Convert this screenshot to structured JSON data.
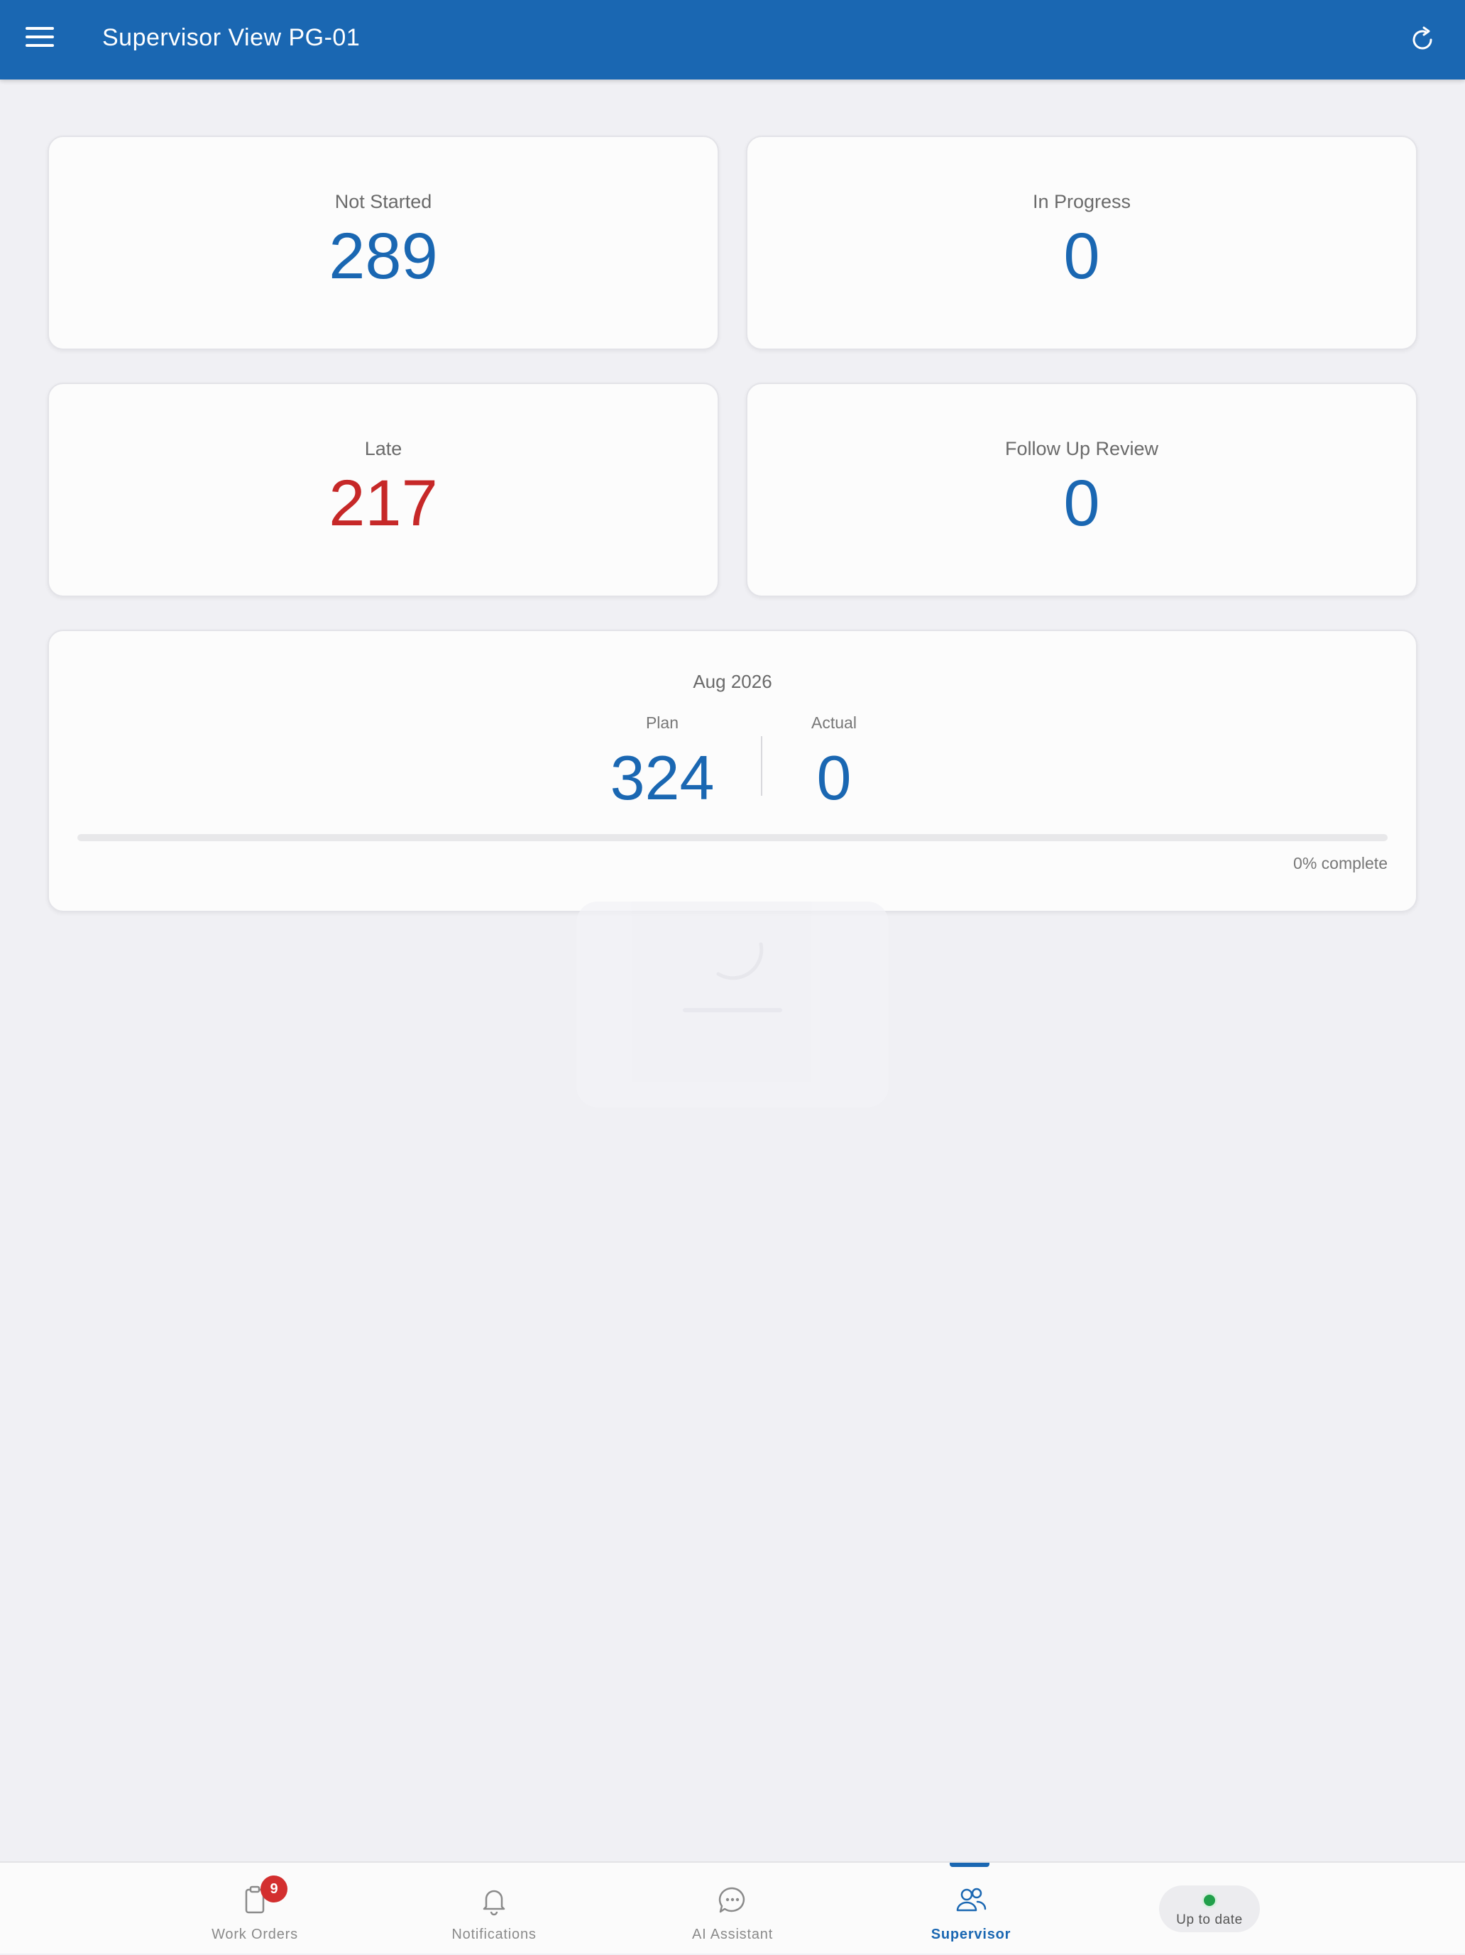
{
  "header": {
    "title": "Supervisor View PG-01",
    "menu_icon": "hamburger-menu-icon",
    "refresh_icon": "refresh-icon"
  },
  "stats": [
    {
      "label": "Not Started",
      "value": "289"
    },
    {
      "label": "In Progress",
      "value": "0"
    },
    {
      "label": "Late",
      "value": "217"
    },
    {
      "label": "Follow Up Review",
      "value": "0"
    }
  ],
  "month_summary": {
    "month": "Aug 2026",
    "plan_label": "Plan",
    "plan_value": "324",
    "actual_label": "Actual",
    "actual_value": "0",
    "progress_percent": 0,
    "progress_text": "0% complete"
  },
  "bottom_nav": {
    "items": [
      {
        "label": "Work Orders",
        "icon": "clipboard-icon",
        "badge": "9"
      },
      {
        "label": "Notifications",
        "icon": "bell-icon"
      },
      {
        "label": "AI Assistant",
        "icon": "chat-bubble-icon"
      },
      {
        "label": "Supervisor",
        "icon": "users-icon",
        "active": true
      }
    ],
    "status": {
      "label": "Up to date",
      "icon": "status-dot-icon"
    }
  },
  "colors": {
    "primary": "#1a67b2",
    "late": "#c62828",
    "badge": "#d32f2f",
    "status_ok": "#22a04b",
    "background": "#f0f0f4"
  }
}
